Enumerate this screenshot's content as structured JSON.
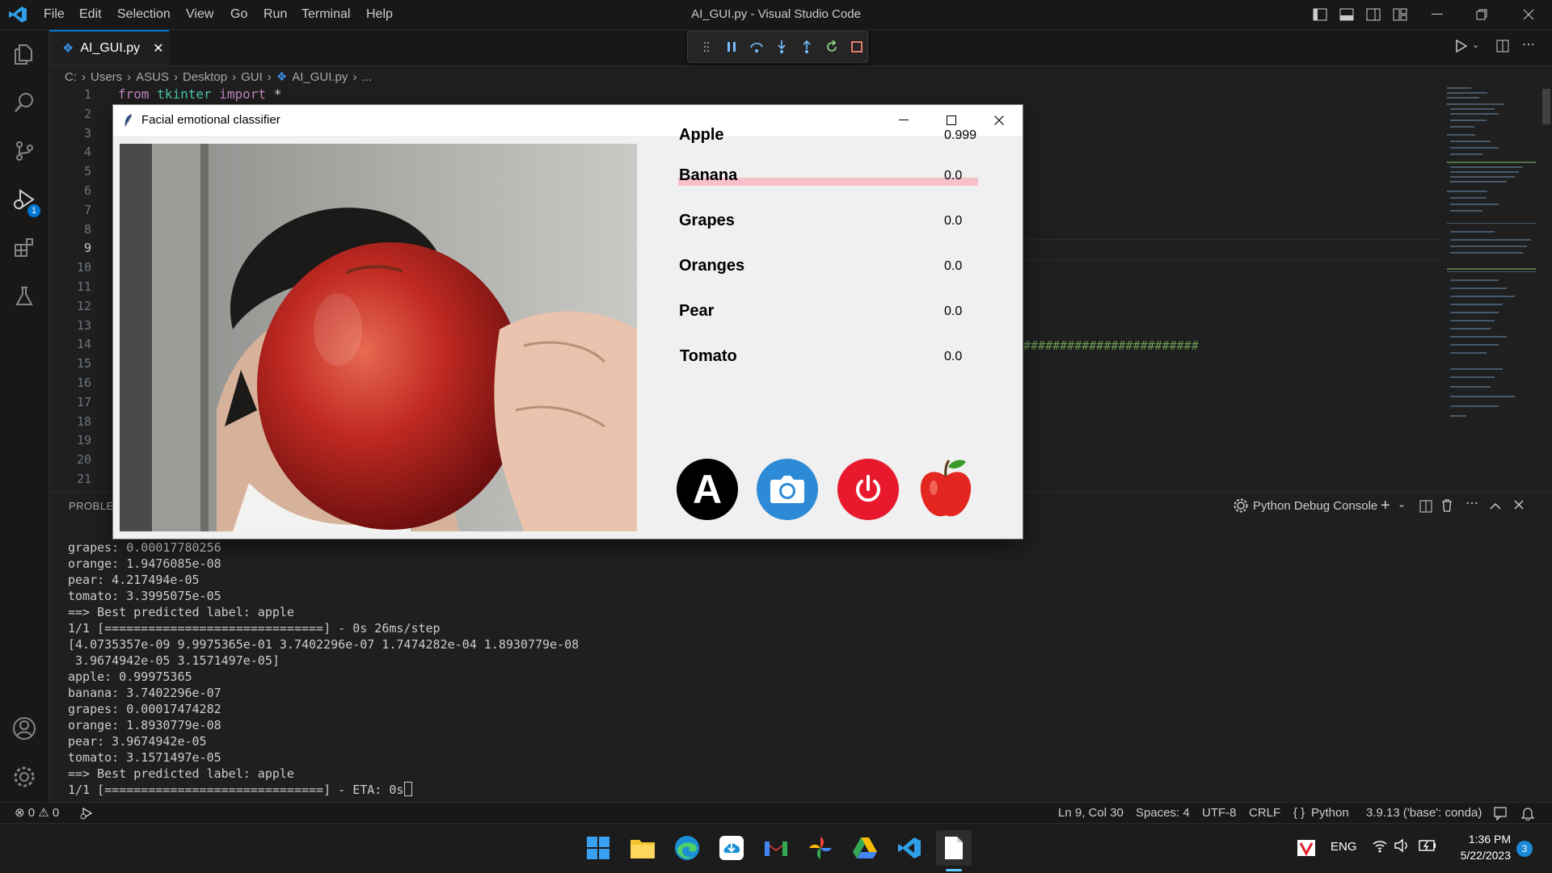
{
  "window": {
    "title": "AI_GUI.py - Visual Studio Code",
    "menu": [
      "File",
      "Edit",
      "Selection",
      "View",
      "Go",
      "Run",
      "Terminal",
      "Help"
    ]
  },
  "editor": {
    "tab_label": "AI_GUI.py",
    "breadcrumb": [
      "C:",
      "Users",
      "ASUS",
      "Desktop",
      "GUI",
      "AI_GUI.py",
      "..."
    ],
    "line_numbers": [
      "1",
      "2",
      "3",
      "4",
      "5",
      "6",
      "7",
      "8",
      "9",
      "10",
      "11",
      "12",
      "13",
      "14",
      "15",
      "16",
      "17",
      "18",
      "19",
      "20",
      "21"
    ],
    "current_line": "9",
    "code_line1": {
      "kw1": "from",
      "mod": "tkinter",
      "kw2": "import",
      "rest": "*"
    },
    "code_line14_tail": "########################"
  },
  "activity": {
    "debug_badge": "1"
  },
  "panel": {
    "tab_label": "PROBLEMS",
    "console_label": "Python Debug Console",
    "console_lines": [
      "grapes: 0.00017780256",
      "orange: 1.9476085e-08",
      "pear: 4.217494e-05",
      "tomato: 3.3995075e-05",
      "==> Best predicted label: apple",
      "1/1 [==============================] - 0s 26ms/step",
      "[4.0735357e-09 9.9975365e-01 3.7402296e-07 1.7474282e-04 1.8930779e-08",
      " 3.9674942e-05 3.1571497e-05]",
      "apple: 0.99975365",
      "banana: 3.7402296e-07",
      "grapes: 0.00017474282",
      "orange: 1.8930779e-08",
      "pear: 3.9674942e-05",
      "tomato: 3.1571497e-05",
      "==> Best predicted label: apple",
      "1/1 [==============================] - ETA: 0s"
    ]
  },
  "statusbar": {
    "errors": "0",
    "warnings": "0",
    "position": "Ln 9, Col 30",
    "spaces": "Spaces: 4",
    "encoding": "UTF-8",
    "eol": "CRLF",
    "language": "Python",
    "interpreter": "3.9.13 ('base': conda)"
  },
  "taskbar": {
    "lang": "ENG",
    "time": "1:36 PM",
    "date": "5/22/2023",
    "notif_count": "3"
  },
  "app": {
    "title": "Facial emotional classifier",
    "predictions": [
      {
        "label": "Apple",
        "value": "0.999",
        "fraction": 0.999
      },
      {
        "label": "Banana",
        "value": "0.0",
        "fraction": 0
      },
      {
        "label": "Grapes",
        "value": "0.0",
        "fraction": 0
      },
      {
        "label": "Oranges",
        "value": "0.0",
        "fraction": 0
      },
      {
        "label": "Pear",
        "value": "0.0",
        "fraction": 0
      },
      {
        "label": "Tomato",
        "value": "0.0",
        "fraction": 0
      }
    ],
    "auto_button_letter": "A",
    "colors": {
      "bar_fill": "#f8c0c8",
      "camera_button": "#2d8ad6",
      "power_button": "#e8192c",
      "accent": "#0078d4"
    }
  }
}
